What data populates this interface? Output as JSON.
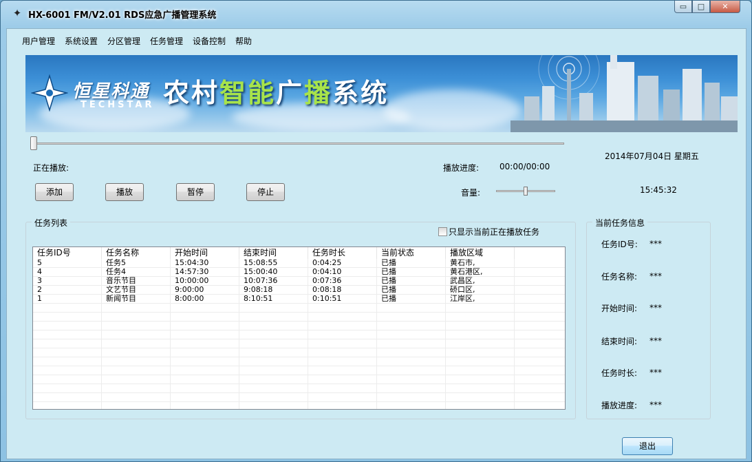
{
  "window": {
    "title": "HX-6001  FM/V2.01 RDS应急广播管理系统",
    "minimize_glyph": "▭",
    "maximize_glyph": "□",
    "close_glyph": "✕"
  },
  "menu": [
    "用户管理",
    "系统设置",
    "分区管理",
    "任务管理",
    "设备控制",
    "帮助"
  ],
  "banner": {
    "brand_cn": "恒星科通",
    "brand_en": "TECHSTAR",
    "system_name_1": "农村",
    "system_name_2": "智能",
    "system_name_3": "广",
    "system_name_4": "播",
    "system_name_5": "系统"
  },
  "player": {
    "now_playing_label": "正在播放:",
    "progress_label": "播放进度:",
    "progress_value": "00:00/00:00",
    "volume_label": "音量:",
    "date": "2014年07月04日   星期五",
    "time": "15:45:32",
    "progress_fraction": 0.0,
    "volume_fraction": 0.5
  },
  "buttons": {
    "add": "添加",
    "play": "播放",
    "pause": "暂停",
    "stop": "停止",
    "exit": "退出"
  },
  "task_list": {
    "group_title": "任务列表",
    "filter_label": "只显示当前正在播放任务",
    "columns": [
      "任务ID号",
      "任务名称",
      "开始时间",
      "结束时间",
      "任务时长",
      "当前状态",
      "播放区域",
      ""
    ],
    "rows": [
      [
        "5",
        "任务5",
        "15:04:30",
        "15:08:55",
        "0:04:25",
        "已播",
        "黄石市,",
        ""
      ],
      [
        "4",
        "任务4",
        "14:57:30",
        "15:00:40",
        "0:04:10",
        "已播",
        "黄石港区,",
        ""
      ],
      [
        "3",
        "音乐节目",
        "10:00:00",
        "10:07:36",
        "0:07:36",
        "已播",
        "武昌区,",
        ""
      ],
      [
        "2",
        "文艺节目",
        "9:00:00",
        "9:08:18",
        "0:08:18",
        "已播",
        "硚口区,",
        ""
      ],
      [
        "1",
        "新闻节目",
        "8:00:00",
        "8:10:51",
        "0:10:51",
        "已播",
        "江岸区,",
        ""
      ]
    ],
    "empty_rows": 12
  },
  "task_info": {
    "group_title": "当前任务信息",
    "items": [
      {
        "label": "任务ID号:",
        "value": "***"
      },
      {
        "label": "任务名称:",
        "value": "***"
      },
      {
        "label": "开始时间:",
        "value": "***"
      },
      {
        "label": "结束时间:",
        "value": "***"
      },
      {
        "label": "任务时长:",
        "value": "***"
      },
      {
        "label": "播放进度:",
        "value": "***"
      }
    ]
  }
}
